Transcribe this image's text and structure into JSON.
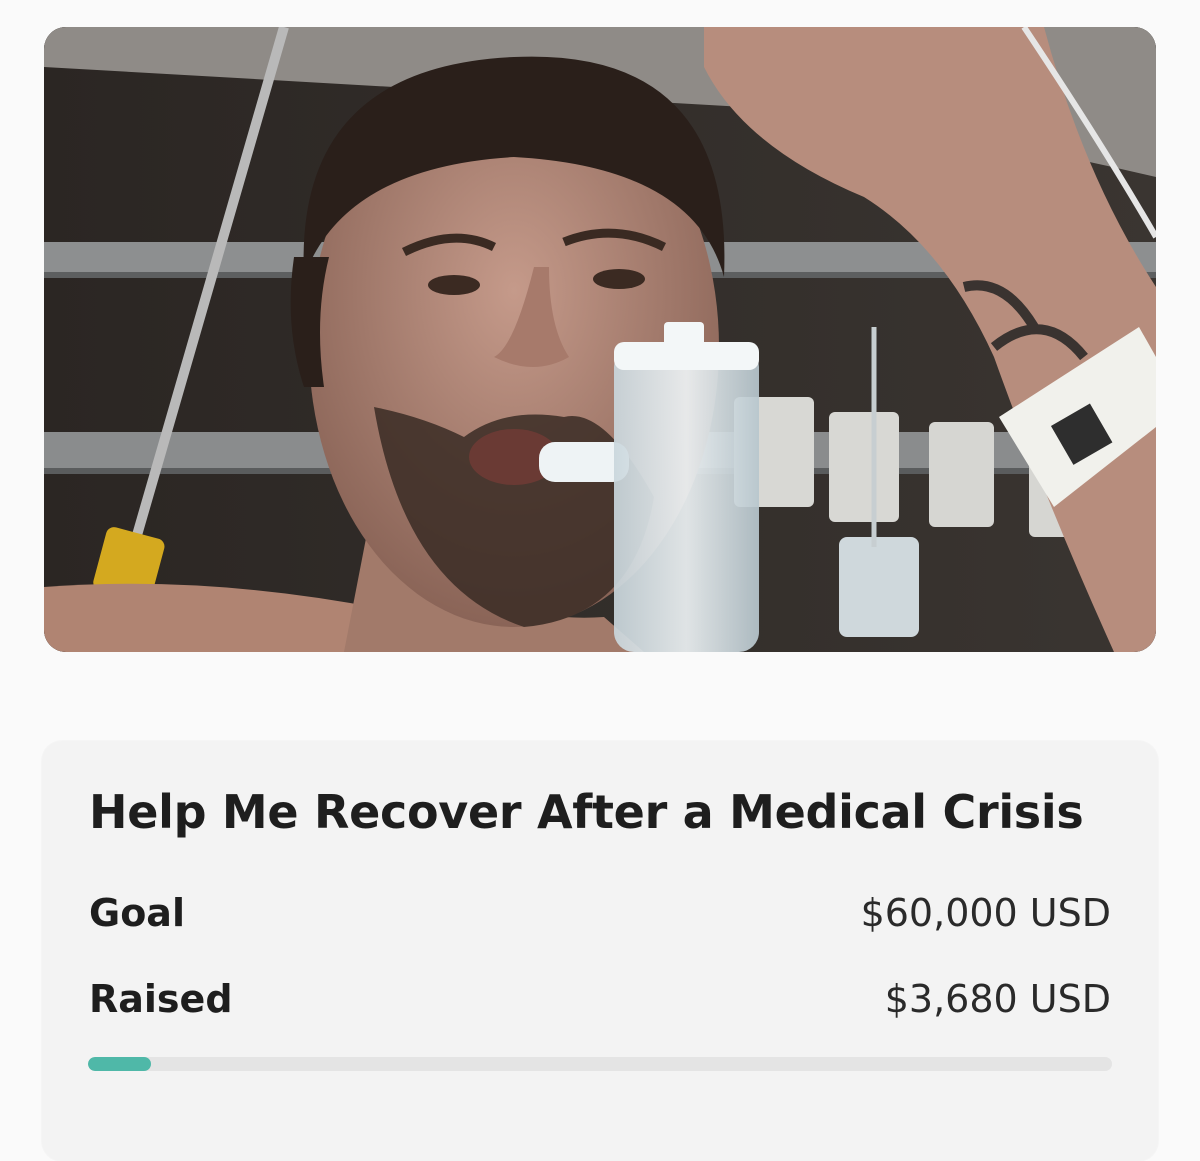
{
  "campaign": {
    "title": "Help Me Recover After a Medical Crisis",
    "photo_alt": "Campaign photo: man in hospital bed using an incentive spirometer",
    "goal_label": "Goal",
    "goal_value": "$60,000 USD",
    "raised_label": "Raised",
    "raised_value": "$3,680 USD",
    "progress_fraction": 0.0613
  },
  "colors": {
    "accent": "#4fb8a8",
    "progress_track": "#e4e4e4",
    "card_bg": "#f3f3f3",
    "page_bg": "#fafafa"
  }
}
